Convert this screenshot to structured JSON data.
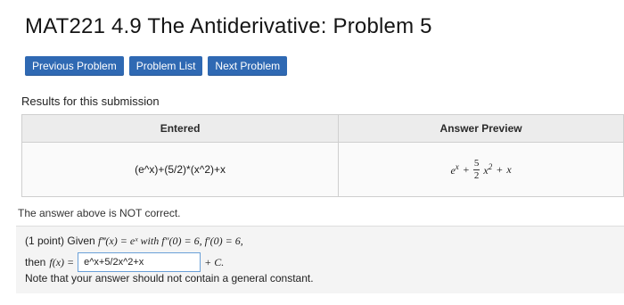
{
  "page": {
    "title": "MAT221 4.9 The Antiderivative: Problem 5"
  },
  "nav": {
    "previous_label": "Previous Problem",
    "list_label": "Problem List",
    "next_label": "Next Problem"
  },
  "results": {
    "heading": "Results for this submission",
    "headers": {
      "entered": "Entered",
      "preview": "Answer Preview"
    },
    "row": {
      "entered": "(e^x)+(5/2)*(x^2)+x",
      "preview": {
        "term1": "e",
        "term1_sup": "x",
        "plus1": "+",
        "frac_num": "5",
        "frac_den": "2",
        "term2": "x",
        "term2_sup": "2",
        "plus2": "+",
        "term3": "x"
      }
    },
    "status": "The answer above is NOT correct."
  },
  "problem": {
    "text_points": "(1 point) Given",
    "given_math": "f‴(x) = eˣ with f″(0) = 6, f′(0) = 6,",
    "then_text": "then",
    "fx_math": "f(x) =",
    "answer_value": "e^x+5/2x^2+x",
    "constant": "+ C.",
    "note": "Note that your answer should not contain a general constant."
  }
}
